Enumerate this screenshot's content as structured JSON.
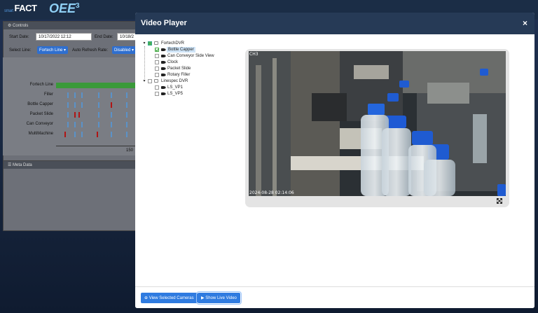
{
  "app": {
    "logo_primary": "FACT",
    "logo_prefix": "smart",
    "logo_secondary": "OEE",
    "logo_secondary_sup": "3"
  },
  "controls": {
    "title": "Controls",
    "start_date_label": "Start Date:",
    "start_date_value": "10/17/2022 12:12",
    "end_date_label": "End Date:",
    "end_date_value": "10/18/2",
    "select_line_label": "Select Line:",
    "select_line_value": "Fortech Line",
    "auto_refresh_label": "Auto Refresh Rate:",
    "auto_refresh_value": "Disabled"
  },
  "timeline": {
    "lanes": [
      "Fortech Line",
      "Filler",
      "Bottle Capper",
      "Packet Slide",
      "Can Conveyor",
      "MultiMachine"
    ],
    "axis_label": "150"
  },
  "meta_panel": {
    "title": "Meta Data"
  },
  "modal": {
    "title": "Video Player",
    "close_symbol": "×",
    "tree": {
      "root1": "FortechDVR",
      "root1_children": [
        "Bottle Capper",
        "Can Conveyor Side View",
        "Clock",
        "Packet Slide",
        "Rotary Filler"
      ],
      "root2": "Linespec DVR",
      "root2_children": [
        "LS_VP1",
        "LS_VP5"
      ]
    },
    "video": {
      "channel": "CH3",
      "timestamp": "2024-08-28 02:14:06"
    },
    "footer": {
      "view_selected": "View Selected Cameras",
      "show_live": "Show Live Video"
    }
  }
}
